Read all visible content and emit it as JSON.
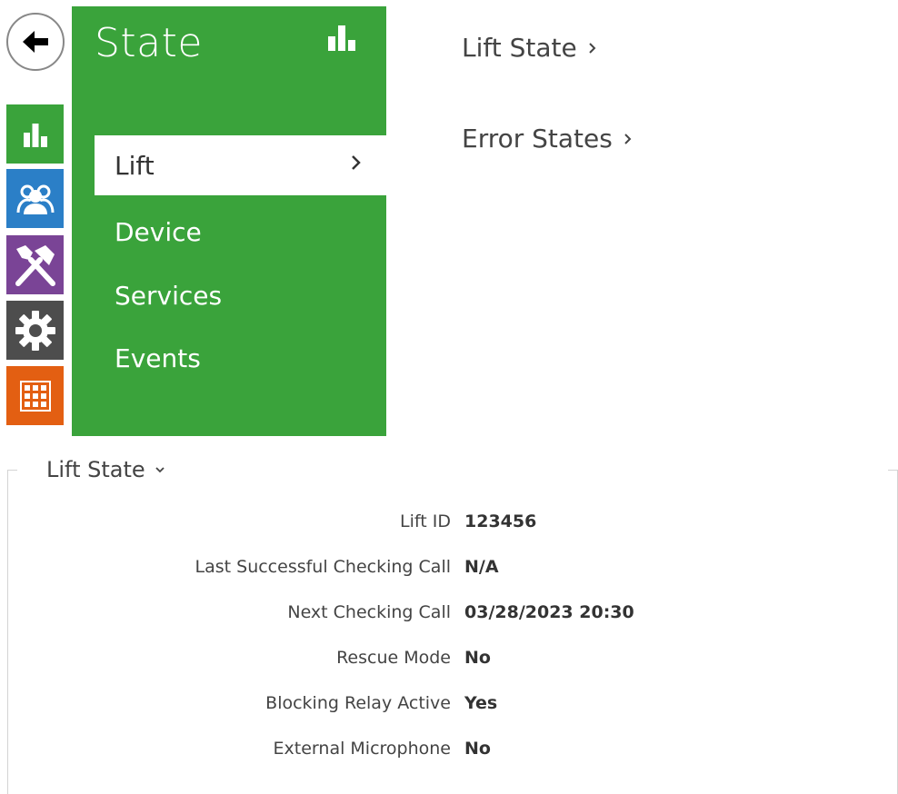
{
  "menu": {
    "title": "State",
    "items": [
      {
        "label": "Lift",
        "active": true
      },
      {
        "label": "Device"
      },
      {
        "label": "Services"
      },
      {
        "label": "Events"
      }
    ]
  },
  "rail": {
    "icons": [
      "bar-chart-icon",
      "users-icon",
      "tools-icon",
      "gear-icon",
      "keypad-icon"
    ],
    "colors": [
      "#3aa33b",
      "#2b7fc7",
      "#7a4496",
      "#4d4d4d",
      "#e35f12"
    ]
  },
  "links": {
    "lift_state": "Lift State",
    "error_states": "Error States"
  },
  "section": {
    "title": "Lift State",
    "rows": [
      {
        "label": "Lift ID",
        "value": "123456"
      },
      {
        "label": "Last Successful Checking Call",
        "value": "N/A"
      },
      {
        "label": "Next Checking Call",
        "value": "03/28/2023 20:30"
      },
      {
        "label": "Rescue Mode",
        "value": "No"
      },
      {
        "label": "Blocking Relay Active",
        "value": "Yes"
      },
      {
        "label": "External Microphone",
        "value": "No"
      }
    ]
  },
  "colors": {
    "accent": "#3aa33b"
  }
}
